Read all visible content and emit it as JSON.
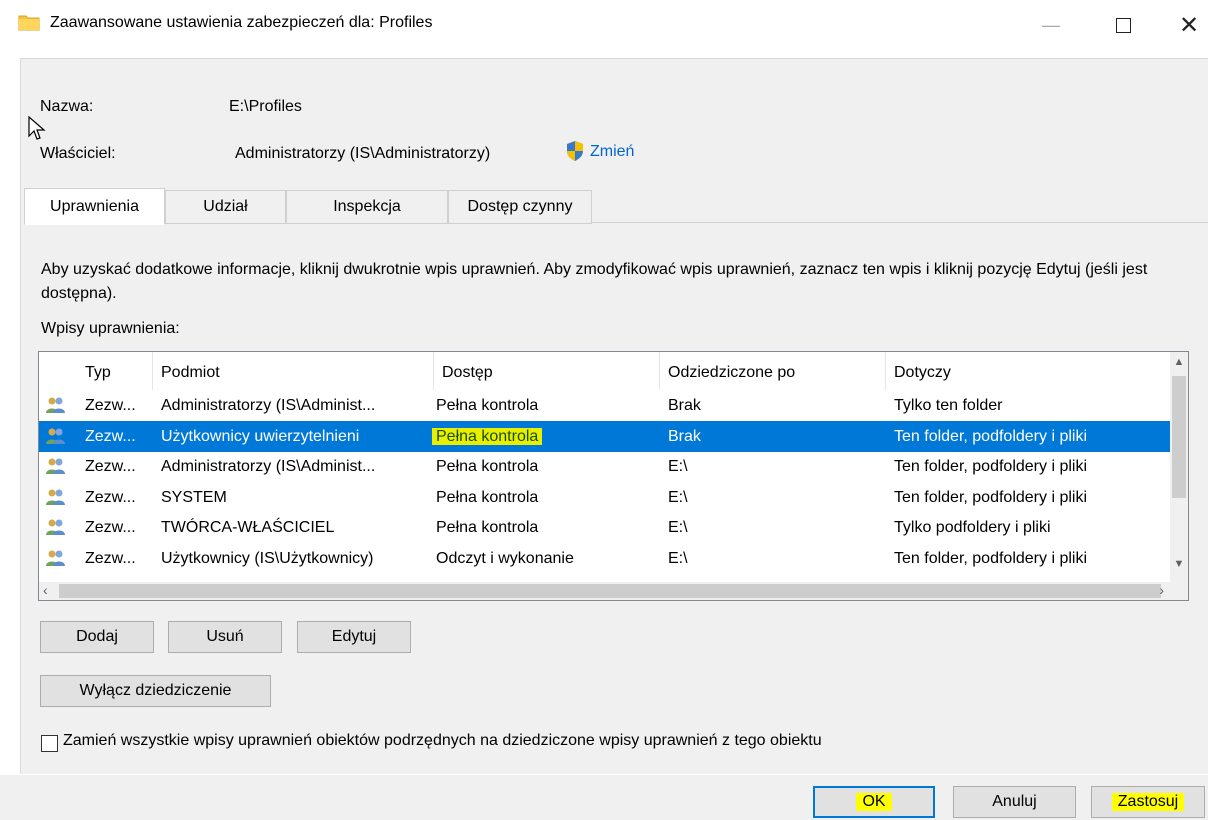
{
  "window": {
    "title": "Zaawansowane ustawienia zabezpieczeń dla: Profiles",
    "icon": "folder-icon",
    "controls": {
      "minimize": "—",
      "maximize": "maximize-icon",
      "close": "✕"
    }
  },
  "info": {
    "name_label": "Nazwa:",
    "name_value": "E:\\Profiles",
    "owner_label": "Właściciel:",
    "owner_value": "Administratorzy (IS\\Administratorzy)",
    "change_link": "Zmień"
  },
  "tabs": [
    {
      "label": "Uprawnienia",
      "active": true
    },
    {
      "label": "Udział",
      "active": false
    },
    {
      "label": "Inspekcja",
      "active": false
    },
    {
      "label": "Dostęp czynny",
      "active": false
    }
  ],
  "description": "Aby uzyskać dodatkowe informacje, kliknij dwukrotnie wpis uprawnień. Aby zmodyfikować wpis uprawnień, zaznacz ten wpis i kliknij pozycję Edytuj (jeśli jest dostępna).",
  "entries_label": "Wpisy uprawnienia:",
  "table": {
    "columns": [
      "Typ",
      "Podmiot",
      "Dostęp",
      "Odziedziczone po",
      "Dotyczy"
    ],
    "rows": [
      {
        "type": "Zezw...",
        "principal": "Administratorzy (IS\\Administ...",
        "access": "Pełna kontrola",
        "inherited": "Brak",
        "applies": "Tylko ten folder",
        "selected": false
      },
      {
        "type": "Zezw...",
        "principal": "Użytkownicy uwierzytelnieni",
        "access": "Pełna kontrola",
        "inherited": "Brak",
        "applies": "Ten folder, podfoldery i pliki",
        "selected": true
      },
      {
        "type": "Zezw...",
        "principal": "Administratorzy (IS\\Administ...",
        "access": "Pełna kontrola",
        "inherited": "E:\\",
        "applies": "Ten folder, podfoldery i pliki",
        "selected": false
      },
      {
        "type": "Zezw...",
        "principal": "SYSTEM",
        "access": "Pełna kontrola",
        "inherited": "E:\\",
        "applies": "Ten folder, podfoldery i pliki",
        "selected": false
      },
      {
        "type": "Zezw...",
        "principal": "TWÓRCA-WŁAŚCICIEL",
        "access": "Pełna kontrola",
        "inherited": "E:\\",
        "applies": "Tylko podfoldery i pliki",
        "selected": false
      },
      {
        "type": "Zezw...",
        "principal": "Użytkownicy (IS\\Użytkownicy)",
        "access": "Odczyt i wykonanie",
        "inherited": "E:\\",
        "applies": "Ten folder, podfoldery i pliki",
        "selected": false
      }
    ]
  },
  "buttons": {
    "add": "Dodaj",
    "remove": "Usuń",
    "edit": "Edytuj",
    "disable_inheritance": "Wyłącz dziedziczenie",
    "ok": "OK",
    "cancel": "Anuluj",
    "apply": "Zastosuj"
  },
  "replace_checkbox_label": "Zamień wszystkie wpisy uprawnień obiektów podrzędnych na dziedziczone wpisy uprawnień z tego obiektu",
  "colors": {
    "selection": "#0078d7",
    "highlight": "#ffff00",
    "link": "#0066cc"
  }
}
